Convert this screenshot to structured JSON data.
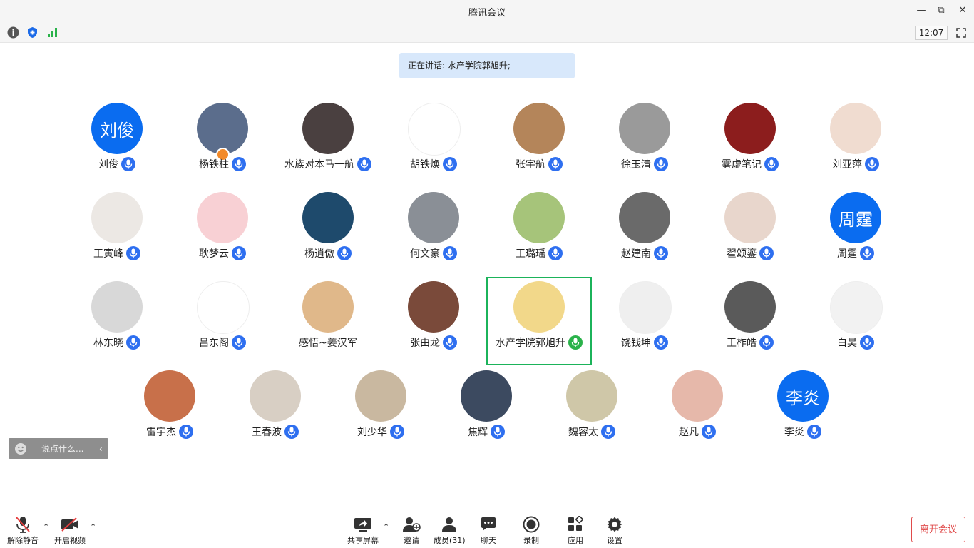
{
  "window": {
    "title": "腾讯会议",
    "clock": "12:07"
  },
  "speaking_banner": "正在讲话: 水产学院郭旭升;",
  "participants": [
    {
      "name": "刘俊",
      "avatar_text": "刘俊",
      "avatar_color": "#0a6cf0",
      "mic": "blue"
    },
    {
      "name": "杨铁柱",
      "avatar_text": "",
      "avatar_color": "#5b6d8c",
      "mic": "blue",
      "host": true
    },
    {
      "name": "水族对本马一航",
      "avatar_text": "",
      "avatar_color": "#4a4040",
      "mic": "blue"
    },
    {
      "name": "胡铁焕",
      "avatar_text": "",
      "avatar_color": "#ffffff",
      "mic": "blue"
    },
    {
      "name": "张宇航",
      "avatar_text": "",
      "avatar_color": "#b4855a",
      "mic": "blue"
    },
    {
      "name": "徐玉清",
      "avatar_text": "",
      "avatar_color": "#9a9a9a",
      "mic": "blue"
    },
    {
      "name": "雾虚笔记",
      "avatar_text": "",
      "avatar_color": "#8c1d1d",
      "mic": "blue"
    },
    {
      "name": "刘亚萍",
      "avatar_text": "",
      "avatar_color": "#f0dcd0",
      "mic": "blue"
    },
    {
      "name": "王寅峰",
      "avatar_text": "",
      "avatar_color": "#ece8e4",
      "mic": "blue"
    },
    {
      "name": "耿梦云",
      "avatar_text": "",
      "avatar_color": "#f8d0d4",
      "mic": "blue"
    },
    {
      "name": "杨逍傲",
      "avatar_text": "",
      "avatar_color": "#1e4a6c",
      "mic": "blue"
    },
    {
      "name": "何文豪",
      "avatar_text": "",
      "avatar_color": "#8a8f96",
      "mic": "blue"
    },
    {
      "name": "王璐瑶",
      "avatar_text": "",
      "avatar_color": "#a6c47a",
      "mic": "blue"
    },
    {
      "name": "赵建南",
      "avatar_text": "",
      "avatar_color": "#6a6a6a",
      "mic": "blue"
    },
    {
      "name": "翟颂鎏",
      "avatar_text": "",
      "avatar_color": "#e8d6cc",
      "mic": "blue"
    },
    {
      "name": "周霆",
      "avatar_text": "周霆",
      "avatar_color": "#0a6cf0",
      "mic": "blue"
    },
    {
      "name": "林东晓",
      "avatar_text": "",
      "avatar_color": "#d8d8d8",
      "mic": "blue"
    },
    {
      "name": "吕东阁",
      "avatar_text": "",
      "avatar_color": "#ffffff",
      "mic": "blue"
    },
    {
      "name": "感悟~姜汉军",
      "avatar_text": "",
      "avatar_color": "#e0b88a",
      "mic": "none"
    },
    {
      "name": "张由龙",
      "avatar_text": "",
      "avatar_color": "#7a4a3a",
      "mic": "blue"
    },
    {
      "name": "水产学院郭旭升",
      "avatar_text": "",
      "avatar_color": "#f2d88a",
      "mic": "green",
      "active": true
    },
    {
      "name": "饶钱坤",
      "avatar_text": "",
      "avatar_color": "#efefef",
      "mic": "blue"
    },
    {
      "name": "王柞皓",
      "avatar_text": "",
      "avatar_color": "#5a5a5a",
      "mic": "blue"
    },
    {
      "name": "白昊",
      "avatar_text": "",
      "avatar_color": "#f2f2f2",
      "mic": "blue"
    },
    {
      "name": "雷宇杰",
      "avatar_text": "",
      "avatar_color": "#c8704a",
      "mic": "blue"
    },
    {
      "name": "王春波",
      "avatar_text": "",
      "avatar_color": "#d8cfc4",
      "mic": "blue"
    },
    {
      "name": "刘少华",
      "avatar_text": "",
      "avatar_color": "#c9b8a0",
      "mic": "blue"
    },
    {
      "name": "焦辉",
      "avatar_text": "",
      "avatar_color": "#3c4a60",
      "mic": "blue"
    },
    {
      "name": "魏容太",
      "avatar_text": "",
      "avatar_color": "#cfc7a8",
      "mic": "blue"
    },
    {
      "name": "赵凡",
      "avatar_text": "",
      "avatar_color": "#e6b8aa",
      "mic": "blue"
    },
    {
      "name": "李炎",
      "avatar_text": "李炎",
      "avatar_color": "#0a6cf0",
      "mic": "blue"
    }
  ],
  "chat": {
    "placeholder": "说点什么..."
  },
  "controls": {
    "unmute": "解除静音",
    "start_video": "开启视频",
    "share_screen": "共享屏幕",
    "invite": "邀请",
    "members": "成员(31)",
    "chat": "聊天",
    "record": "录制",
    "apps": "应用",
    "settings": "设置",
    "leave": "离开会议"
  }
}
